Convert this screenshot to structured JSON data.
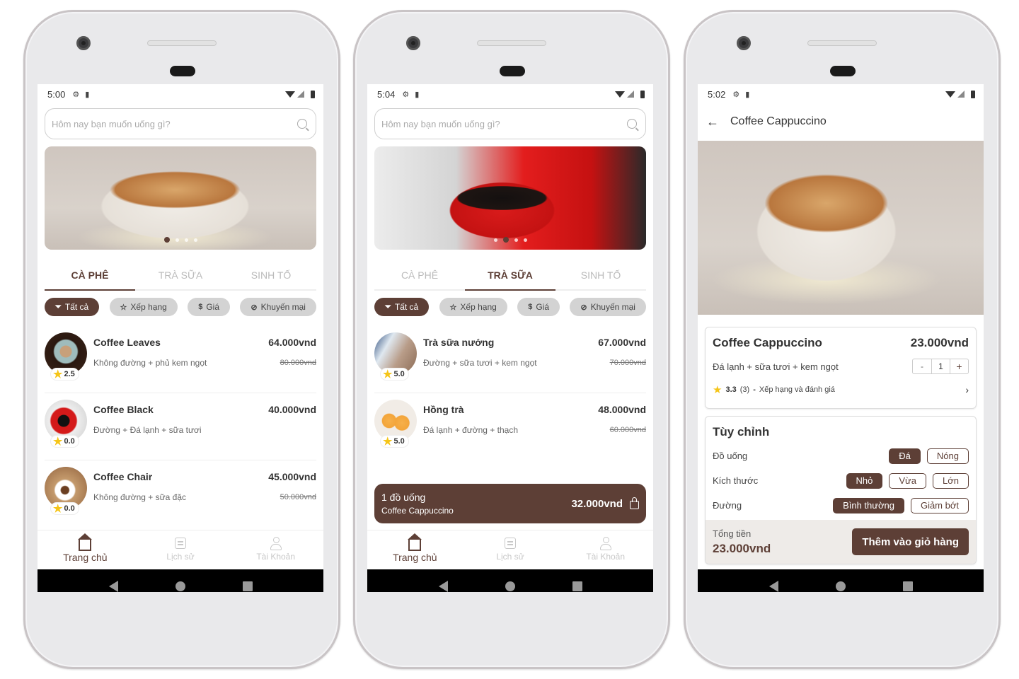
{
  "colors": {
    "accent": "#5d3f36",
    "star": "#f5c518"
  },
  "phones": [
    {
      "status": {
        "time": "5:00"
      },
      "search": {
        "placeholder": "Hôm nay bạn muốn uống gì?"
      },
      "banner": {
        "active_dot": 1,
        "dot_count": 4
      },
      "tabs": [
        {
          "label": "CÀ PHÊ",
          "active": true
        },
        {
          "label": "TRÀ SỮA",
          "active": false
        },
        {
          "label": "SINH TỐ",
          "active": false
        }
      ],
      "filters": [
        {
          "icon": "filter-icon",
          "label": "Tất cả",
          "active": true
        },
        {
          "icon": "star-outline-icon",
          "label": "Xếp hạng"
        },
        {
          "icon": "dollar-icon",
          "label": "Giá"
        },
        {
          "icon": "promo-icon",
          "label": "Khuyến mại"
        }
      ],
      "items": [
        {
          "name": "Coffee Leaves",
          "desc": "Không đường + phủ kem ngọt",
          "price": "64.000vnd",
          "old_price": "80.000vnd",
          "rating": "2.5"
        },
        {
          "name": "Coffee Black",
          "desc": "Đường + Đá lạnh + sữa tươi",
          "price": "40.000vnd",
          "old_price": "",
          "rating": "0.0"
        },
        {
          "name": "Coffee Chair",
          "desc": "Không đường + sữa đặc",
          "price": "45.000vnd",
          "old_price": "50.000vnd",
          "rating": "0.0"
        }
      ],
      "nav": [
        {
          "label": "Trang chủ",
          "active": true
        },
        {
          "label": "Lịch sử"
        },
        {
          "label": "Tài Khoản"
        }
      ]
    },
    {
      "status": {
        "time": "5:04"
      },
      "search": {
        "placeholder": "Hôm nay bạn muốn uống gì?"
      },
      "banner": {
        "active_dot": 2,
        "dot_count": 4
      },
      "tabs": [
        {
          "label": "CÀ PHÊ",
          "active": false
        },
        {
          "label": "TRÀ SỮA",
          "active": true
        },
        {
          "label": "SINH TỐ",
          "active": false
        }
      ],
      "filters": [
        {
          "icon": "filter-icon",
          "label": "Tất cả",
          "active": true
        },
        {
          "icon": "star-outline-icon",
          "label": "Xếp hạng"
        },
        {
          "icon": "dollar-icon",
          "label": "Giá"
        },
        {
          "icon": "promo-icon",
          "label": "Khuyến mại"
        }
      ],
      "items": [
        {
          "name": "Trà sữa nướng",
          "desc": "Đường + sữa tươi + kem ngọt",
          "price": "67.000vnd",
          "old_price": "70.000vnd",
          "rating": "5.0"
        },
        {
          "name": "Hồng trà",
          "desc": "Đá lạnh + đường + thạch",
          "price": "48.000vnd",
          "old_price": "60.000vnd",
          "rating": "5.0"
        }
      ],
      "cart": {
        "count": "1 đồ uống",
        "name": "Coffee Cappuccino",
        "total": "32.000vnd"
      },
      "nav": [
        {
          "label": "Trang chủ",
          "active": true
        },
        {
          "label": "Lịch sử"
        },
        {
          "label": "Tài Khoản"
        }
      ]
    },
    {
      "status": {
        "time": "5:02"
      },
      "appbar": {
        "title": "Coffee Cappuccino"
      },
      "product": {
        "name": "Coffee Cappuccino",
        "price": "23.000vnd",
        "desc": "Đá lạnh + sữa tươi + kem ngọt",
        "quantity": "1",
        "minus": "-",
        "plus": "+",
        "rating": "3.3",
        "rating_count": "(3)",
        "rating_sep": "-",
        "rating_link": "Xếp hạng và đánh giá"
      },
      "custom": {
        "title": "Tùy chỉnh",
        "options": [
          {
            "label": "Đồ uống",
            "choices": [
              {
                "label": "Đá",
                "active": true
              },
              {
                "label": "Nóng"
              }
            ]
          },
          {
            "label": "Kích thước",
            "choices": [
              {
                "label": "Nhỏ",
                "active": true
              },
              {
                "label": "Vừa"
              },
              {
                "label": "Lớn"
              }
            ]
          },
          {
            "label": "Đường",
            "choices": [
              {
                "label": "Bình thường",
                "active": true
              },
              {
                "label": "Giảm bớt"
              }
            ]
          }
        ]
      },
      "total": {
        "label": "Tổng tiền",
        "value": "23.000vnd",
        "button": "Thêm vào giỏ hàng"
      }
    }
  ]
}
